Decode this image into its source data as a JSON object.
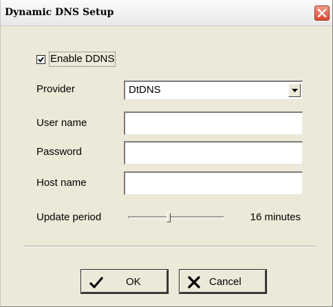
{
  "window": {
    "title": "Dynamic DNS Setup"
  },
  "enable": {
    "label": "Enable DDNS",
    "checked": true
  },
  "provider": {
    "label": "Provider",
    "value": "DtDNS"
  },
  "user_name": {
    "label": "User name",
    "value": ""
  },
  "password": {
    "label": "Password",
    "value": ""
  },
  "host_name": {
    "label": "Host name",
    "value": ""
  },
  "update_period": {
    "label": "Update period",
    "value_text": "16 minutes",
    "slider_level": 0.42
  },
  "buttons": {
    "ok": "OK",
    "cancel": "Cancel"
  },
  "icons": {
    "close": "close-icon",
    "check": "checkmark-icon",
    "cancel": "x-icon",
    "dropdown": "chevron-down-icon"
  }
}
